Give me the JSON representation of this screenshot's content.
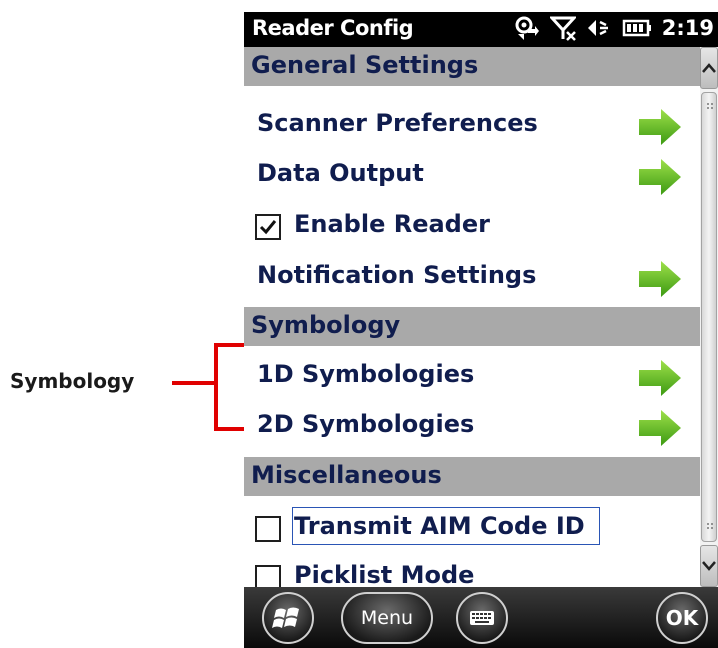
{
  "callout": {
    "label": "Symbology",
    "color": "#e00000"
  },
  "statusbar": {
    "title": "Reader Config",
    "time": "2:19",
    "icons": [
      "connectivity-icon",
      "signal-off-icon",
      "volume-icon",
      "battery-icon"
    ]
  },
  "sections": {
    "general": "General Settings",
    "symbology": "Symbology",
    "misc": "Miscellaneous"
  },
  "items": {
    "scanner_prefs": "Scanner Preferences",
    "data_output": "Data Output",
    "enable_reader": "Enable Reader",
    "enable_reader_checked": true,
    "notification_settings": "Notification Settings",
    "sym_1d": "1D Symbologies",
    "sym_2d": "2D Symbologies",
    "transmit_aim": "Transmit AIM Code ID",
    "transmit_aim_checked": false,
    "picklist": "Picklist Mode",
    "picklist_checked": false
  },
  "bottombar": {
    "start_icon": "windows-start-icon",
    "menu_label": "Menu",
    "keyboard_icon": "keyboard-icon",
    "ok_label": "OK"
  },
  "colors": {
    "section_bg": "#a9a9a9",
    "text": "#101d4e",
    "arrow": "#6bbd1e"
  }
}
